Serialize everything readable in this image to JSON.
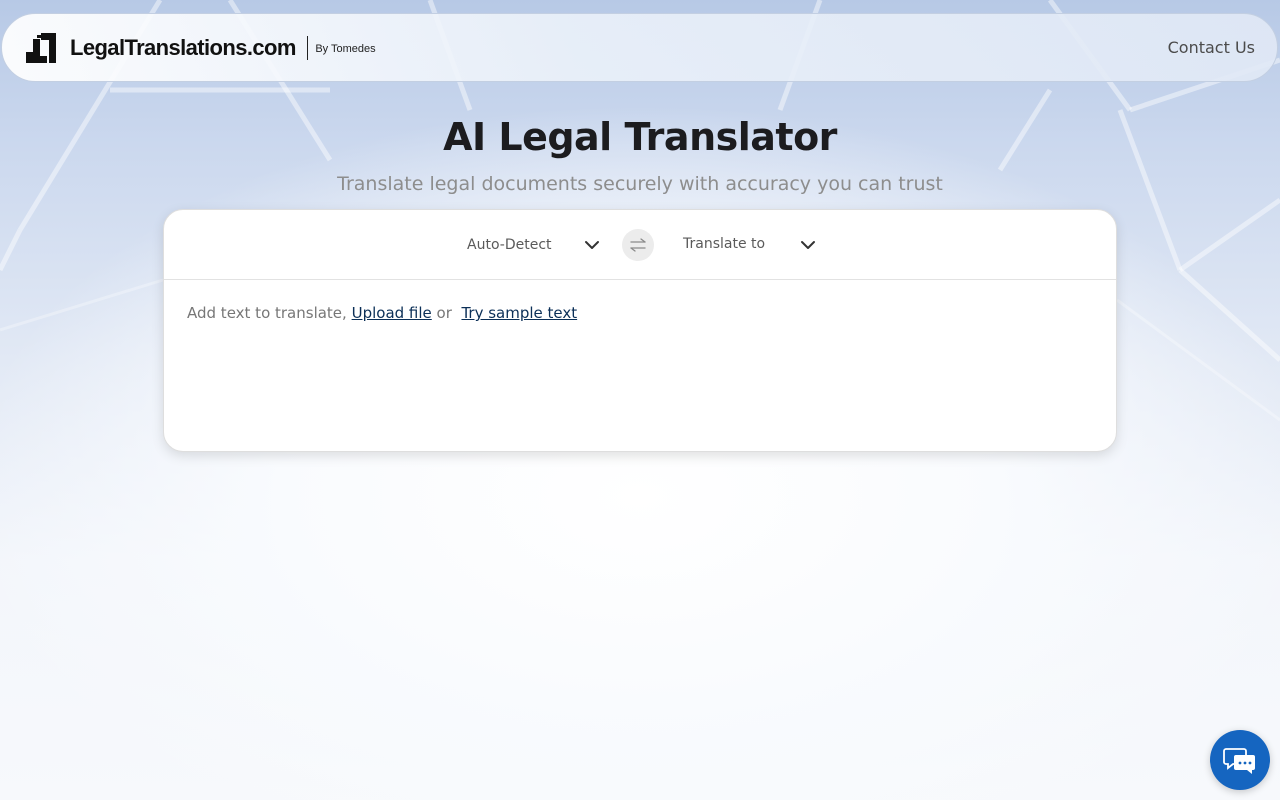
{
  "header": {
    "logo_text": "LegalTranslations.com",
    "logo_by": "By Tomedes",
    "contact_label": "Contact Us"
  },
  "hero": {
    "title": "AI Legal Translator",
    "subtitle": "Translate legal documents securely with accuracy you can trust"
  },
  "translator": {
    "source_language": "Auto-Detect",
    "target_language_placeholder": "Translate to",
    "prompt_text": "Add text to translate,",
    "upload_link": "Upload file",
    "or_text": "or",
    "sample_link": "Try sample text"
  },
  "icons": {
    "logo": "legaltranslations-logo-icon",
    "chevron": "chevron-down-icon",
    "swap": "swap-arrows-icon",
    "chat": "chat-bubble-icon"
  },
  "colors": {
    "accent_link": "#0b2f57",
    "chat_button": "#1565c0",
    "title": "#1c1c1f",
    "subtitle": "#8d8d8d"
  }
}
